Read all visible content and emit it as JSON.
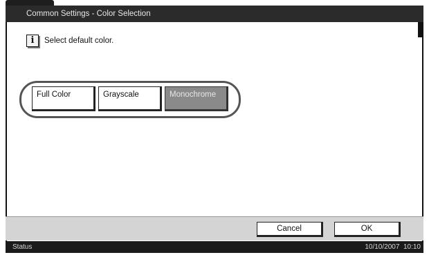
{
  "window": {
    "title": "Common Settings - Color Selection"
  },
  "message": {
    "text": "Select default color.",
    "icon": "info-icon"
  },
  "options": {
    "full_color": "Full Color",
    "grayscale": "Grayscale",
    "monochrome": "Monochrome",
    "selected": "Monochrome"
  },
  "footer": {
    "cancel_label": "Cancel",
    "ok_label": "OK"
  },
  "status_bar": {
    "label": "Status",
    "date": "10/10/2007",
    "time": "10:10"
  },
  "colors": {
    "title_bar": "#2b2b2b",
    "selected_option": "#8a8a8a",
    "bottom_bar": "#d4d4d4",
    "status_bar": "#1a1a1a"
  }
}
